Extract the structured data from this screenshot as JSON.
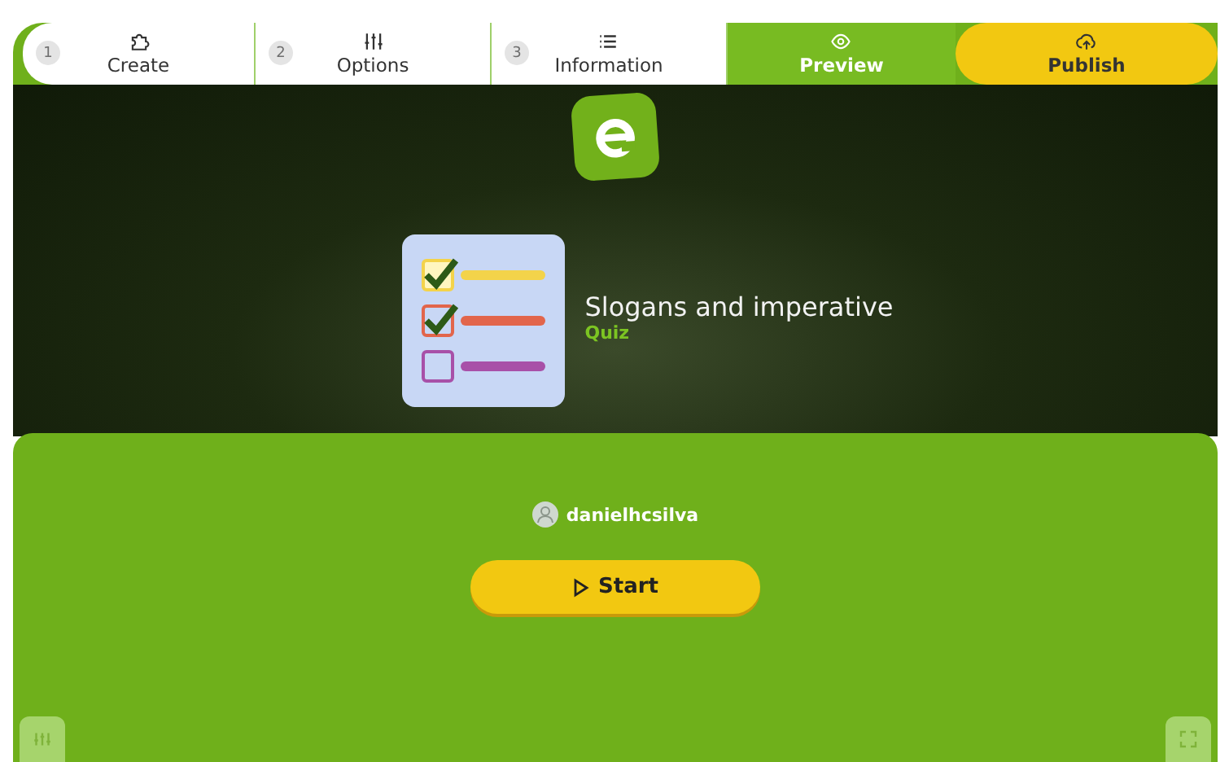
{
  "steps": [
    {
      "number": "1",
      "label": "Create",
      "kind": "step",
      "selected": false
    },
    {
      "number": "2",
      "label": "Options",
      "kind": "step",
      "selected": false
    },
    {
      "number": "3",
      "label": "Information",
      "kind": "step",
      "selected": false
    },
    {
      "label": "Preview",
      "kind": "preview",
      "selected": true
    },
    {
      "label": "Publish",
      "kind": "publish",
      "selected": false
    }
  ],
  "activity": {
    "title": "Slogans and imperative",
    "type": "Quiz"
  },
  "author": "danielhcsilva",
  "start_button": "Start"
}
